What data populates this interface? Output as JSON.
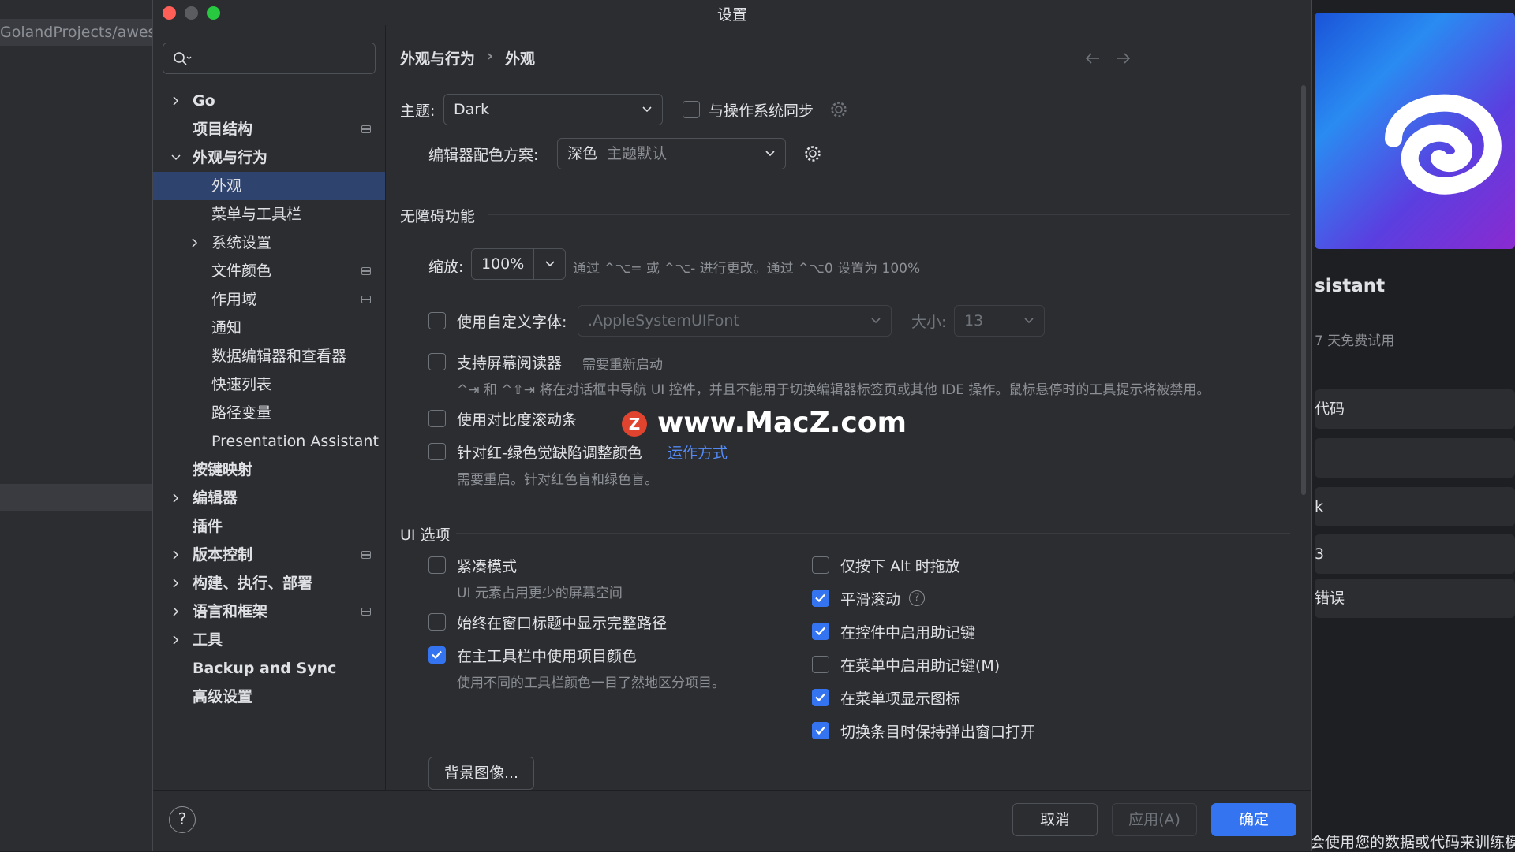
{
  "background": {
    "path_text": "GolandProjects/aweso",
    "right_title": "sistant",
    "right_subtitle": "7 天免费试用",
    "right_items": [
      "代码",
      "",
      "k",
      "3",
      "错误"
    ],
    "right_bottom": "会使用您的数据或代码来训练模"
  },
  "dialog": {
    "title": "设置",
    "search": {
      "placeholder": ""
    },
    "tree": [
      {
        "label": "Go",
        "bold": true,
        "expandable": true,
        "expanded": false,
        "indent": 0,
        "pinned": false
      },
      {
        "label": "项目结构",
        "bold": true,
        "expandable": false,
        "indent": 0,
        "pinned": true
      },
      {
        "label": "外观与行为",
        "bold": true,
        "expandable": true,
        "expanded": true,
        "indent": 0,
        "pinned": false
      },
      {
        "label": "外观",
        "bold": false,
        "expandable": false,
        "indent": 1,
        "pinned": false,
        "selected": true
      },
      {
        "label": "菜单与工具栏",
        "bold": false,
        "expandable": false,
        "indent": 1,
        "pinned": false
      },
      {
        "label": "系统设置",
        "bold": false,
        "expandable": true,
        "expanded": false,
        "indent": 1,
        "pinned": false
      },
      {
        "label": "文件颜色",
        "bold": false,
        "expandable": false,
        "indent": 1,
        "pinned": true
      },
      {
        "label": "作用域",
        "bold": false,
        "expandable": false,
        "indent": 1,
        "pinned": true
      },
      {
        "label": "通知",
        "bold": false,
        "expandable": false,
        "indent": 1,
        "pinned": false
      },
      {
        "label": "数据编辑器和查看器",
        "bold": false,
        "expandable": false,
        "indent": 1,
        "pinned": false
      },
      {
        "label": "快速列表",
        "bold": false,
        "expandable": false,
        "indent": 1,
        "pinned": false
      },
      {
        "label": "路径变量",
        "bold": false,
        "expandable": false,
        "indent": 1,
        "pinned": false
      },
      {
        "label": "Presentation Assistant",
        "bold": false,
        "expandable": false,
        "indent": 1,
        "pinned": false
      },
      {
        "label": "按键映射",
        "bold": true,
        "expandable": false,
        "indent": 0,
        "pinned": false
      },
      {
        "label": "编辑器",
        "bold": true,
        "expandable": true,
        "expanded": false,
        "indent": 0,
        "pinned": false
      },
      {
        "label": "插件",
        "bold": true,
        "expandable": false,
        "indent": 0,
        "pinned": false
      },
      {
        "label": "版本控制",
        "bold": true,
        "expandable": true,
        "expanded": false,
        "indent": 0,
        "pinned": true
      },
      {
        "label": "构建、执行、部署",
        "bold": true,
        "expandable": true,
        "expanded": false,
        "indent": 0,
        "pinned": false
      },
      {
        "label": "语言和框架",
        "bold": true,
        "expandable": true,
        "expanded": false,
        "indent": 0,
        "pinned": true
      },
      {
        "label": "工具",
        "bold": true,
        "expandable": true,
        "expanded": false,
        "indent": 0,
        "pinned": false
      },
      {
        "label": "Backup and Sync",
        "bold": true,
        "expandable": false,
        "indent": 0,
        "pinned": false
      },
      {
        "label": "高级设置",
        "bold": true,
        "expandable": false,
        "indent": 0,
        "pinned": false
      }
    ],
    "breadcrumb": {
      "parent": "外观与行为",
      "separator": "›",
      "current": "外观"
    },
    "theme": {
      "label": "主题:",
      "value": "Dark",
      "sync_label": "与操作系统同步",
      "sync_checked": false
    },
    "scheme": {
      "label": "编辑器配色方案:",
      "value": "深色",
      "value_hint": "主题默认"
    },
    "accessibility": {
      "title": "无障碍功能",
      "zoom_label": "缩放:",
      "zoom_value": "100%",
      "zoom_hint": "通过 ^⌥= 或 ^⌥- 进行更改。通过 ^⌥0 设置为 100%",
      "custom_font_label": "使用自定义字体:",
      "custom_font_checked": false,
      "font_value": ".AppleSystemUIFont",
      "size_label": "大小:",
      "size_value": "13",
      "screen_reader_label": "支持屏幕阅读器",
      "screen_reader_checked": false,
      "screen_reader_hint": "需要重新启动",
      "screen_reader_desc": "^⇥ 和 ^⇧⇥ 将在对话框中导航 UI 控件，并且不能用于切换编辑器标签页或其他 IDE 操作。鼠标悬停时的工具提示将被禁用。",
      "contrast_label": "使用对比度滚动条",
      "contrast_checked": false,
      "color_adjust_label": "针对红-绿色觉缺陷调整颜色",
      "color_adjust_checked": false,
      "color_adjust_link": "运作方式",
      "color_adjust_desc": "需要重启。针对红色盲和绿色盲。"
    },
    "ui_options": {
      "title": "UI 选项",
      "left": [
        {
          "label": "紧凑模式",
          "checked": false,
          "desc": "UI 元素占用更少的屏幕空间"
        },
        {
          "label": "始终在窗口标题中显示完整路径",
          "checked": false,
          "desc": ""
        },
        {
          "label": "在主工具栏中使用项目颜色",
          "checked": true,
          "desc": "使用不同的工具栏颜色一目了然地区分项目。"
        }
      ],
      "right": [
        {
          "label": "仅按下 Alt 时拖放",
          "checked": false
        },
        {
          "label": "平滑滚动",
          "checked": true,
          "help": "?"
        },
        {
          "label": "在控件中启用助记键",
          "checked": true
        },
        {
          "label": "在菜单中启用助记键(M)",
          "checked": false
        },
        {
          "label": "在菜单项显示图标",
          "checked": true
        },
        {
          "label": "切换条目时保持弹出窗口打开",
          "checked": true
        }
      ],
      "bg_image_button": "背景图像..."
    },
    "footer": {
      "help": "?",
      "cancel": "取消",
      "apply": "应用(A)",
      "ok": "确定"
    },
    "watermark": {
      "badge": "Z",
      "text": "www.MacZ.com"
    }
  },
  "colors": {
    "accent": "#3574f0",
    "link": "#548af7",
    "selection": "#2e436e",
    "dialog_bg": "#2b2d30"
  }
}
